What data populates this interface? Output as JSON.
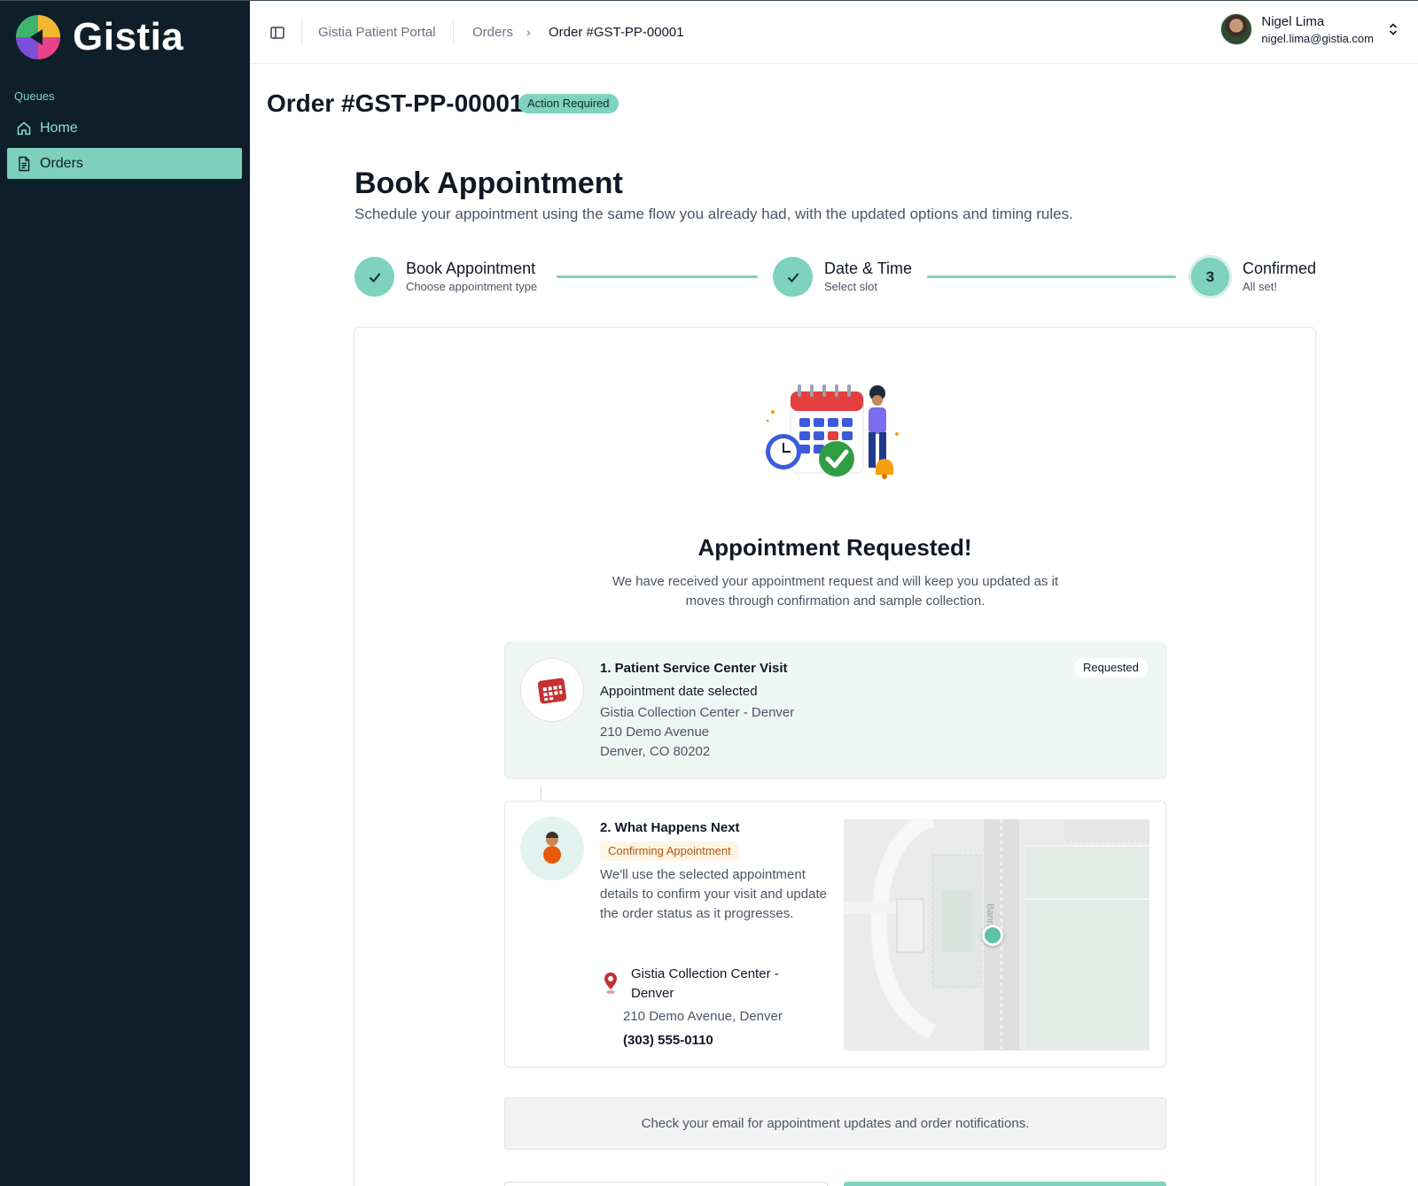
{
  "app": {
    "brand": "Gistia"
  },
  "sidebar": {
    "section_label": "Queues",
    "items": [
      {
        "label": "Home",
        "icon": "home-icon",
        "active": false
      },
      {
        "label": "Orders",
        "icon": "document-icon",
        "active": true
      }
    ]
  },
  "topbar": {
    "breadcrumb": [
      "Gistia Patient Portal",
      "Orders",
      "Order #GST-PP-00001"
    ],
    "user": {
      "name": "Nigel Lima",
      "email": "nigel.lima@gistia.com"
    }
  },
  "order": {
    "title": "Order #GST-PP-00001",
    "status_badge": "Action Required"
  },
  "booking": {
    "heading": "Book Appointment",
    "subheading": "Schedule your appointment using the same flow you already had, with the updated options and timing rules.",
    "steps": [
      {
        "title": "Book Appointment",
        "subtitle": "Choose appointment type",
        "state": "complete"
      },
      {
        "title": "Date & Time",
        "subtitle": "Select slot",
        "state": "complete"
      },
      {
        "number": "3",
        "title": "Confirmed",
        "subtitle": "All set!",
        "state": "current"
      }
    ]
  },
  "confirmation": {
    "title": "Appointment Requested!",
    "message": "We have received your appointment request and will keep you updated as it moves through confirmation and sample collection.",
    "visit": {
      "heading": "1. Patient Service Center Visit",
      "badge": "Requested",
      "status_line": "Appointment date selected",
      "location_name": "Gistia Collection Center - Denver",
      "address_line1": "210 Demo Avenue",
      "address_line2": "Denver, CO 80202"
    },
    "next": {
      "heading": "2. What Happens Next",
      "badge": "Confirming Appointment",
      "description": "We'll use the selected appointment details to confirm your visit and update the order status as it progresses.",
      "location_name": "Gistia Collection Center - Denver",
      "address": "210 Demo Avenue, Denver",
      "phone": "(303) 555-0110",
      "map_street_label": "Bann"
    },
    "email_note": "Check your email for appointment updates and order notifications."
  },
  "colors": {
    "sidebar_bg": "#0f1f2a",
    "accent": "#7ed2bf",
    "badge_confirming_text": "#b45309"
  }
}
